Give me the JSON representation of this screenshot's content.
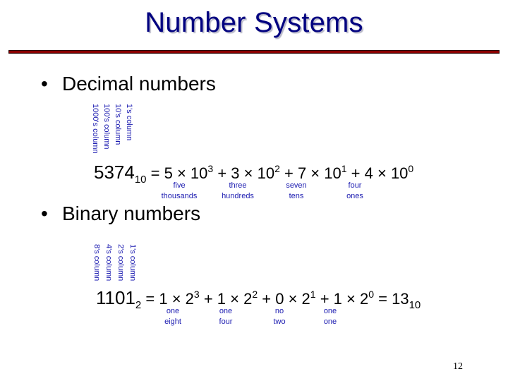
{
  "slide": {
    "title": "Number Systems",
    "page_number": "12",
    "accent_rule_color": "#8b0000",
    "title_color": "#000080"
  },
  "decimal": {
    "bullet": "•",
    "heading": "Decimal numbers",
    "column_labels": [
      "1000's column",
      "100's column",
      "10's column",
      "1's column"
    ],
    "equation": {
      "number": "5374",
      "base": "10",
      "terms": [
        {
          "lead": "= 5 × 10",
          "exp": "3"
        },
        {
          "lead": "+ 3 × 10",
          "exp": "2"
        },
        {
          "lead": "+ 7 × 10",
          "exp": "1"
        },
        {
          "lead": "+ 4 × 10",
          "exp": "0"
        }
      ]
    },
    "notes": [
      {
        "line1": "five",
        "line2": "thousands"
      },
      {
        "line1": "three",
        "line2": "hundreds"
      },
      {
        "line1": "seven",
        "line2": "tens"
      },
      {
        "line1": "four",
        "line2": "ones"
      }
    ]
  },
  "binary": {
    "bullet": "•",
    "heading": "Binary numbers",
    "column_labels": [
      "8's column",
      "4's column",
      "2's column",
      "1's column"
    ],
    "equation": {
      "number": "1101",
      "base": "2",
      "terms": [
        {
          "lead": "= 1 × 2",
          "exp": "3"
        },
        {
          "lead": "+ 1 × 2",
          "exp": "2"
        },
        {
          "lead": "+ 0 × 2",
          "exp": "1"
        },
        {
          "lead": "+ 1 × 2",
          "exp": "0"
        }
      ],
      "result": "= 13",
      "result_base": "10"
    },
    "notes": [
      {
        "line1": "one",
        "line2": "eight"
      },
      {
        "line1": "one",
        "line2": "four"
      },
      {
        "line1": "no",
        "line2": "two"
      },
      {
        "line1": "one",
        "line2": "one"
      }
    ]
  }
}
